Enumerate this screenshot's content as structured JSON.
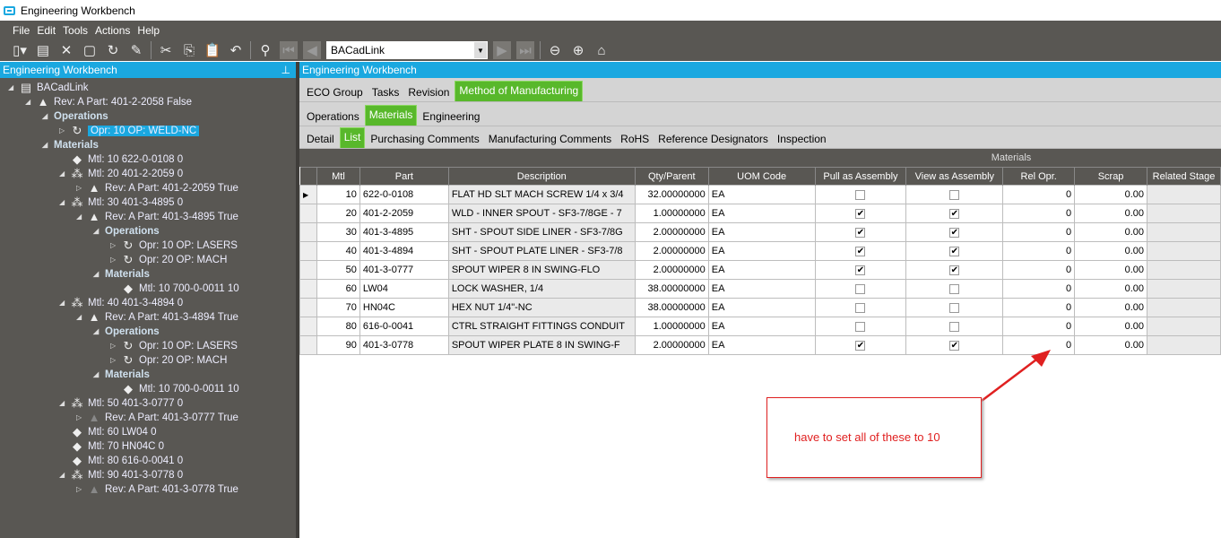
{
  "window": {
    "title": "Engineering Workbench"
  },
  "menu": [
    "File",
    "Edit",
    "Tools",
    "Actions",
    "Help"
  ],
  "toolbar": {
    "combo_value": "BACadLink"
  },
  "left_panel": {
    "title": "Engineering Workbench",
    "tree": [
      {
        "level": 0,
        "icon": "clipboard",
        "exp": "open",
        "label": "BACadLink"
      },
      {
        "level": 1,
        "icon": "revision",
        "exp": "open",
        "label": "Rev: A Part: 401-2-2058 False"
      },
      {
        "level": 2,
        "icon": "",
        "exp": "open",
        "label": "Operations",
        "header": true
      },
      {
        "level": 3,
        "icon": "operation",
        "exp": "closed",
        "label": "Opr: 10 OP: WELD-NC",
        "selected": true
      },
      {
        "level": 2,
        "icon": "",
        "exp": "open",
        "label": "Materials",
        "header": true
      },
      {
        "level": 3,
        "icon": "tag",
        "exp": "",
        "label": "Mtl: 10 622-0-0108 0"
      },
      {
        "level": 3,
        "icon": "assembly",
        "exp": "open",
        "label": "Mtl: 20 401-2-2059 0"
      },
      {
        "level": 4,
        "icon": "revision",
        "exp": "closed",
        "label": "Rev: A Part: 401-2-2059 True"
      },
      {
        "level": 3,
        "icon": "assembly",
        "exp": "open",
        "label": "Mtl: 30 401-3-4895 0"
      },
      {
        "level": 4,
        "icon": "revision",
        "exp": "open",
        "label": "Rev: A Part: 401-3-4895 True"
      },
      {
        "level": 5,
        "icon": "",
        "exp": "open",
        "label": "Operations",
        "header": true
      },
      {
        "level": 6,
        "icon": "operation",
        "exp": "closed",
        "label": "Opr: 10 OP: LASERS"
      },
      {
        "level": 6,
        "icon": "operation",
        "exp": "closed",
        "label": "Opr: 20 OP: MACH"
      },
      {
        "level": 5,
        "icon": "",
        "exp": "open",
        "label": "Materials",
        "header": true
      },
      {
        "level": 6,
        "icon": "tag",
        "exp": "",
        "label": "Mtl: 10 700-0-0011 10"
      },
      {
        "level": 3,
        "icon": "assembly",
        "exp": "open",
        "label": "Mtl: 40 401-3-4894 0"
      },
      {
        "level": 4,
        "icon": "revision",
        "exp": "open",
        "label": "Rev: A Part: 401-3-4894 True"
      },
      {
        "level": 5,
        "icon": "",
        "exp": "open",
        "label": "Operations",
        "header": true
      },
      {
        "level": 6,
        "icon": "operation",
        "exp": "closed",
        "label": "Opr: 10 OP: LASERS"
      },
      {
        "level": 6,
        "icon": "operation",
        "exp": "closed",
        "label": "Opr: 20 OP: MACH"
      },
      {
        "level": 5,
        "icon": "",
        "exp": "open",
        "label": "Materials",
        "header": true
      },
      {
        "level": 6,
        "icon": "tag",
        "exp": "",
        "label": "Mtl: 10 700-0-0011 10"
      },
      {
        "level": 3,
        "icon": "assembly",
        "exp": "open",
        "label": "Mtl: 50 401-3-0777 0"
      },
      {
        "level": 4,
        "icon": "revision-dim",
        "exp": "closed",
        "label": "Rev: A Part: 401-3-0777 True"
      },
      {
        "level": 3,
        "icon": "tag",
        "exp": "",
        "label": "Mtl: 60 LW04 0"
      },
      {
        "level": 3,
        "icon": "tag",
        "exp": "",
        "label": "Mtl: 70 HN04C 0"
      },
      {
        "level": 3,
        "icon": "tag",
        "exp": "",
        "label": "Mtl: 80 616-0-0041 0"
      },
      {
        "level": 3,
        "icon": "assembly",
        "exp": "open",
        "label": "Mtl: 90 401-3-0778 0"
      },
      {
        "level": 4,
        "icon": "revision-dim",
        "exp": "closed",
        "label": "Rev: A Part: 401-3-0778 True"
      }
    ]
  },
  "right_panel": {
    "title": "Engineering Workbench",
    "tabs1": [
      "ECO Group",
      "Tasks",
      "Revision",
      "Method of Manufacturing"
    ],
    "tabs1_active": 3,
    "tabs2": [
      "Operations",
      "Materials",
      "Engineering"
    ],
    "tabs2_active": 1,
    "tabs3": [
      "Detail",
      "List",
      "Purchasing Comments",
      "Manufacturing Comments",
      "RoHS",
      "Reference Designators",
      "Inspection"
    ],
    "tabs3_active": 1,
    "grid": {
      "title": "Materials",
      "columns": [
        "Mtl",
        "Part",
        "Description",
        "Qty/Parent",
        "UOM Code",
        "Pull as Assembly",
        "View as Assembly",
        "Rel Opr.",
        "Scrap",
        "Related Stage"
      ],
      "rows": [
        [
          "10",
          "622-0-0108",
          "FLAT HD SLT MACH SCREW 1/4 x 3/4",
          "32.00000000",
          "EA",
          false,
          false,
          "0",
          "0.00",
          ""
        ],
        [
          "20",
          "401-2-2059",
          "WLD - INNER SPOUT - SF3-7/8GE - 7",
          "1.00000000",
          "EA",
          true,
          true,
          "0",
          "0.00",
          ""
        ],
        [
          "30",
          "401-3-4895",
          "SHT - SPOUT SIDE LINER - SF3-7/8G",
          "2.00000000",
          "EA",
          true,
          true,
          "0",
          "0.00",
          ""
        ],
        [
          "40",
          "401-3-4894",
          "SHT - SPOUT PLATE LINER - SF3-7/8",
          "2.00000000",
          "EA",
          true,
          true,
          "0",
          "0.00",
          ""
        ],
        [
          "50",
          "401-3-0777",
          "SPOUT WIPER 8 IN SWING-FLO",
          "2.00000000",
          "EA",
          true,
          true,
          "0",
          "0.00",
          ""
        ],
        [
          "60",
          "LW04",
          "LOCK WASHER, 1/4",
          "38.00000000",
          "EA",
          false,
          false,
          "0",
          "0.00",
          ""
        ],
        [
          "70",
          "HN04C",
          "HEX NUT 1/4\"-NC",
          "38.00000000",
          "EA",
          false,
          false,
          "0",
          "0.00",
          ""
        ],
        [
          "80",
          "616-0-0041",
          "CTRL STRAIGHT FITTINGS CONDUIT",
          "1.00000000",
          "EA",
          false,
          false,
          "0",
          "0.00",
          ""
        ],
        [
          "90",
          "401-3-0778",
          "SPOUT WIPER PLATE 8 IN SWING-F",
          "2.00000000",
          "EA",
          true,
          true,
          "0",
          "0.00",
          ""
        ]
      ]
    }
  },
  "annotation": {
    "text": "have to set all of these to 10",
    "color": "#e02020"
  }
}
